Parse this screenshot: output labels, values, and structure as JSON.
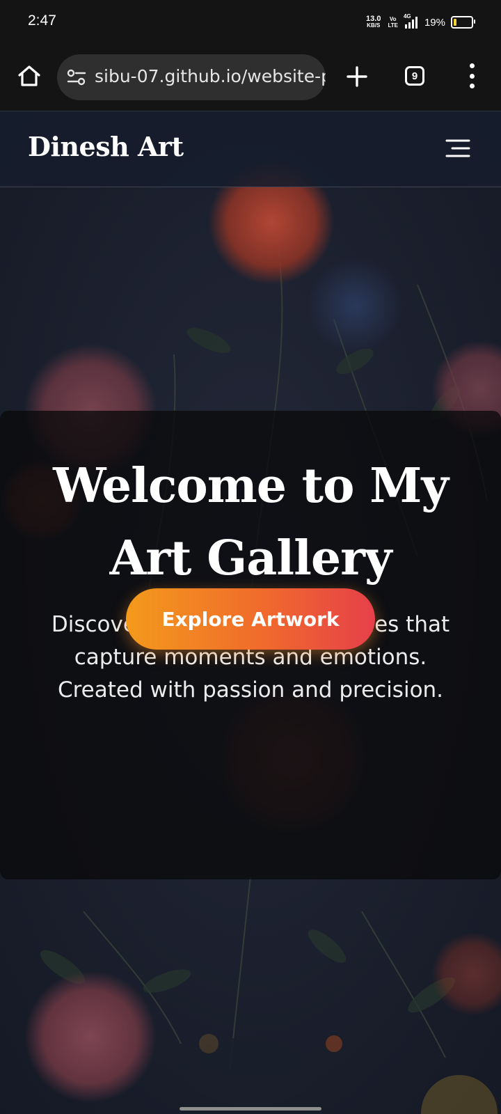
{
  "status_bar": {
    "time": "2:47",
    "net_speed_value": "13.0",
    "net_speed_unit": "KB/S",
    "volte_top": "Vo",
    "volte_bottom": "LTE",
    "network_type": "4G",
    "battery_percent": "19%",
    "battery_level": 0.19,
    "battery_color": "#f3d23a"
  },
  "browser": {
    "url": "sibu-07.github.io/website-p",
    "tab_count": "9"
  },
  "site": {
    "brand": "Dinesh Art",
    "hero_title": "Welcome to My Art Gallery",
    "hero_subtitle": "Discover unique pencil sketches that capture moments and emotions. Created with passion and precision.",
    "cta_label": "Explore Artwork"
  },
  "colors": {
    "cta_gradient_start": "#f39a1c",
    "cta_gradient_end": "#e6404a",
    "page_background": "#1b1f2c",
    "header_text": "#ffffff"
  },
  "icons": {
    "home": "home-icon",
    "site_info": "tune-icon",
    "new_tab": "plus-icon",
    "tabs": "tab-switcher-icon",
    "menu": "more-vert-icon",
    "nav_menu": "hamburger-icon"
  }
}
